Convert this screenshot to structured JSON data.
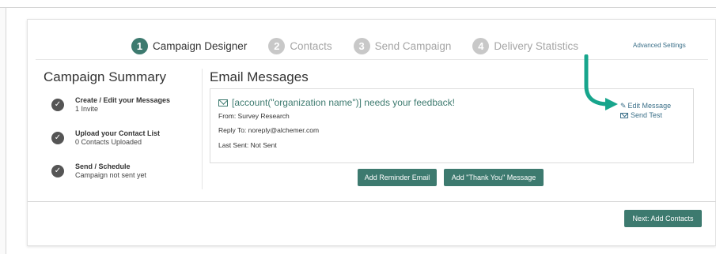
{
  "steps": [
    {
      "num": "1",
      "label": "Campaign Designer"
    },
    {
      "num": "2",
      "label": "Contacts"
    },
    {
      "num": "3",
      "label": "Send Campaign"
    },
    {
      "num": "4",
      "label": "Delivery Statistics"
    }
  ],
  "advanced_settings": "Advanced Settings",
  "summary": {
    "title": "Campaign Summary",
    "items": [
      {
        "title": "Create / Edit your Messages",
        "sub": "1 Invite"
      },
      {
        "title": "Upload your Contact List",
        "sub": "0 Contacts Uploaded"
      },
      {
        "title": "Send / Schedule",
        "sub": "Campaign not sent yet"
      }
    ]
  },
  "email_messages": {
    "title": "Email Messages",
    "message": {
      "subject": "[account(\"organization name\")] needs your feedback!",
      "from": "From: Survey Research",
      "reply_to": "Reply To: noreply@alchemer.com",
      "last_sent": "Last Sent: Not Sent",
      "edit_label": "Edit Message",
      "send_test_label": "Send Test"
    }
  },
  "buttons": {
    "add_reminder": "Add Reminder Email",
    "add_thank_you": "Add \"Thank You\" Message",
    "next": "Next: Add Contacts"
  },
  "colors": {
    "accent": "#3d7a6f",
    "link": "#3a6f88",
    "annotation_arrow": "#17a58c"
  }
}
